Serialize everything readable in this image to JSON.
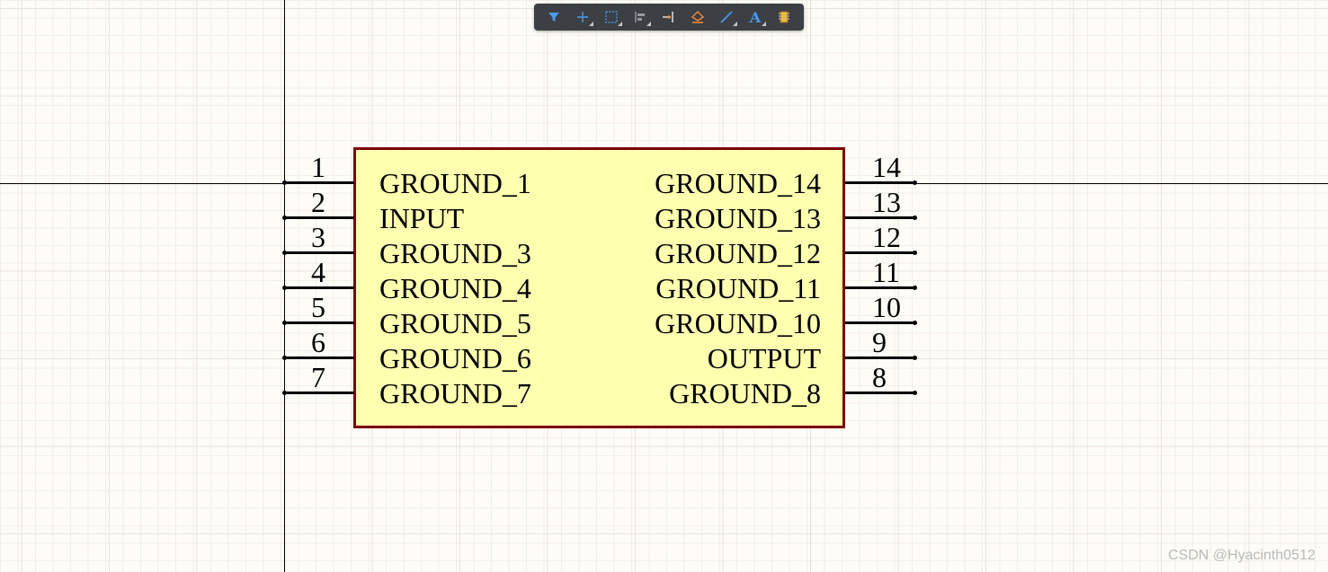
{
  "toolbar": {
    "buttons": [
      {
        "icon": "filter-icon",
        "has_dropdown": false
      },
      {
        "icon": "plus-icon",
        "has_dropdown": true
      },
      {
        "icon": "selection-rect-icon",
        "has_dropdown": true
      },
      {
        "icon": "align-icon",
        "has_dropdown": true
      },
      {
        "icon": "place-pin-icon",
        "has_dropdown": false
      },
      {
        "icon": "fill-shape-icon",
        "has_dropdown": false
      },
      {
        "icon": "line-icon",
        "has_dropdown": true
      },
      {
        "icon": "text-icon",
        "has_dropdown": true
      },
      {
        "icon": "component-icon",
        "has_dropdown": false
      }
    ],
    "text_button_glyph": "A"
  },
  "component": {
    "body_fill": "#ffffb0",
    "border_color": "#7a0000",
    "left_pins": [
      {
        "number": "1",
        "name": "GROUND_1"
      },
      {
        "number": "2",
        "name": "INPUT"
      },
      {
        "number": "3",
        "name": "GROUND_3"
      },
      {
        "number": "4",
        "name": "GROUND_4"
      },
      {
        "number": "5",
        "name": "GROUND_5"
      },
      {
        "number": "6",
        "name": "GROUND_6"
      },
      {
        "number": "7",
        "name": "GROUND_7"
      }
    ],
    "right_pins": [
      {
        "number": "14",
        "name": "GROUND_14"
      },
      {
        "number": "13",
        "name": "GROUND_13"
      },
      {
        "number": "12",
        "name": "GROUND_12"
      },
      {
        "number": "11",
        "name": "GROUND_11"
      },
      {
        "number": "10",
        "name": "GROUND_10"
      },
      {
        "number": "9",
        "name": "OUTPUT"
      },
      {
        "number": "8",
        "name": "GROUND_8"
      }
    ]
  },
  "watermark": "CSDN @Hyacinth0512",
  "colors": {
    "canvas_bg": "#fdfcf6",
    "toolbar_bg": "#3c3f44",
    "icon_blue": "#4a9bf0",
    "icon_orange": "#f08a3c"
  }
}
